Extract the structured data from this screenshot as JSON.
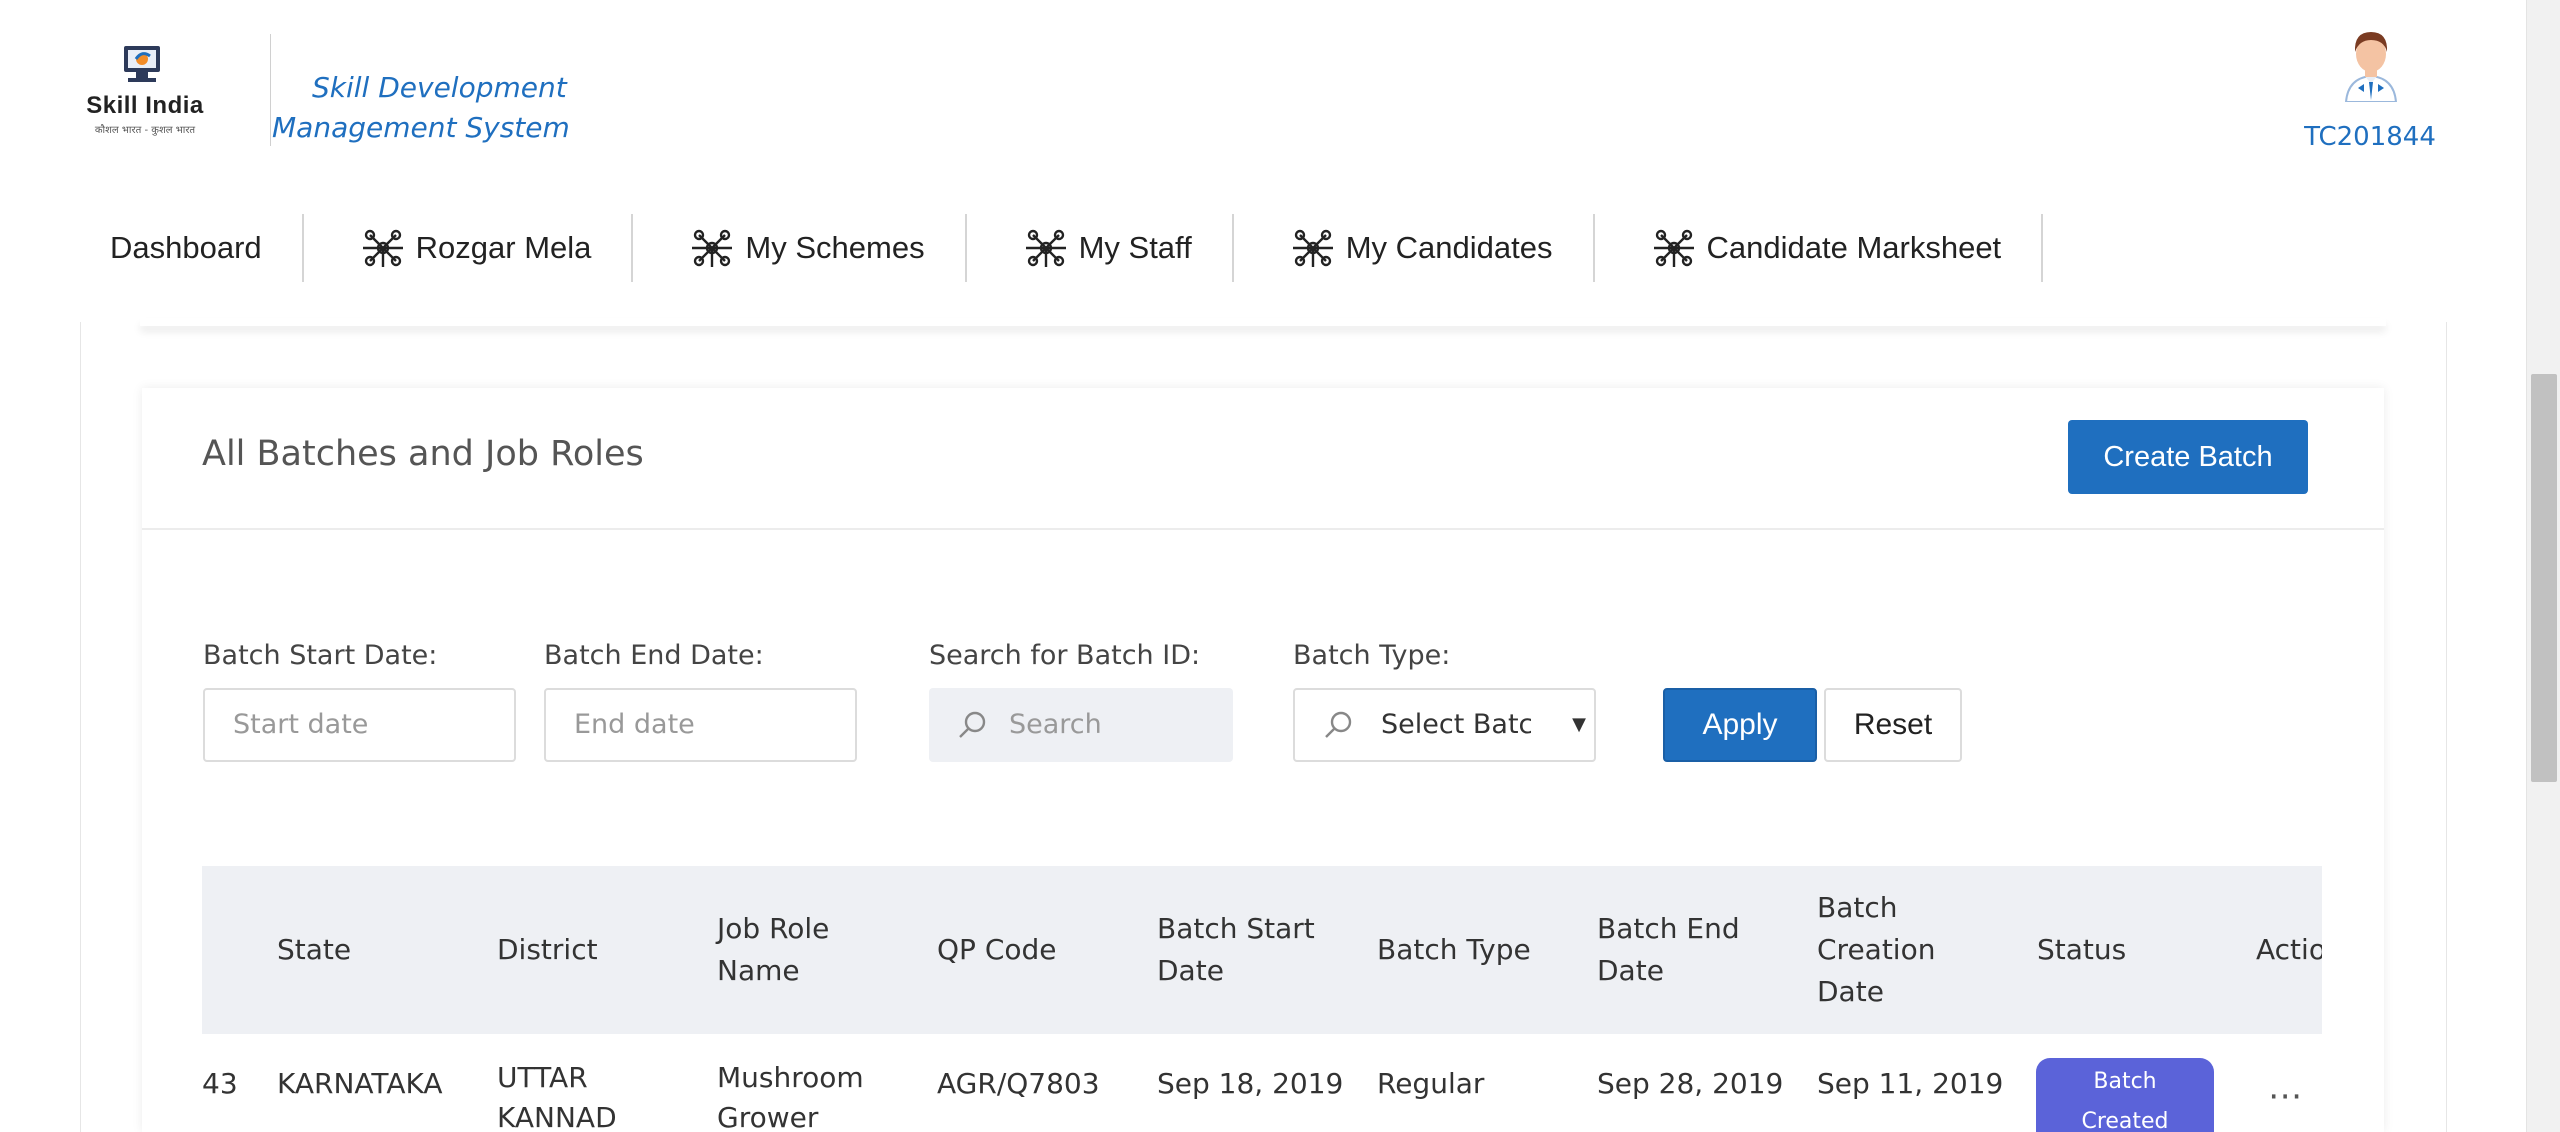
{
  "header": {
    "logo_text": "Skill India",
    "logo_subtext": "कौशल भारत - कुशल भारत",
    "app_title": "Skill Development Management System",
    "user_id": "TC201844"
  },
  "nav": {
    "items": [
      {
        "label": "Dashboard",
        "icon": "none"
      },
      {
        "label": "Rozgar Mela",
        "icon": "network-icon"
      },
      {
        "label": "My Schemes",
        "icon": "network-icon"
      },
      {
        "label": "My Staff",
        "icon": "network-icon"
      },
      {
        "label": "My Candidates",
        "icon": "network-icon"
      },
      {
        "label": "Candidate Marksheet",
        "icon": "network-icon"
      }
    ]
  },
  "card": {
    "title": "All Batches and Job Roles",
    "create_button": "Create Batch"
  },
  "filters": {
    "start_date_label": "Batch Start Date:",
    "start_date_placeholder": "Start date",
    "end_date_label": "Batch End Date:",
    "end_date_placeholder": "End date",
    "batch_id_label": "Search for Batch ID:",
    "batch_id_placeholder": "Search",
    "batch_type_label": "Batch Type:",
    "batch_type_placeholder": "Select Batch Type",
    "apply_button": "Apply",
    "reset_button": "Reset"
  },
  "table": {
    "columns": [
      "State",
      "District",
      "Job Role\nName",
      "QP Code",
      "Batch Start\nDate",
      "Batch Type",
      "Batch End\nDate",
      "Batch\nCreation\nDate",
      "Status",
      "Actio"
    ],
    "rows": [
      {
        "id_fragment": "43",
        "state": "KARNATAKA",
        "district": "UTTAR\nKANNAD",
        "job_role": "Mushroom\nGrower",
        "qp_code": "AGR/Q7803",
        "batch_start": "Sep 18, 2019",
        "batch_type": "Regular",
        "batch_end": "Sep 28, 2019",
        "creation_date": "Sep 11, 2019",
        "status": "Batch\nCreated",
        "action": "⋯"
      }
    ]
  },
  "colors": {
    "primary": "#1f6fbf",
    "status_badge": "#5b63d9",
    "table_header_bg": "#eef0f4"
  }
}
